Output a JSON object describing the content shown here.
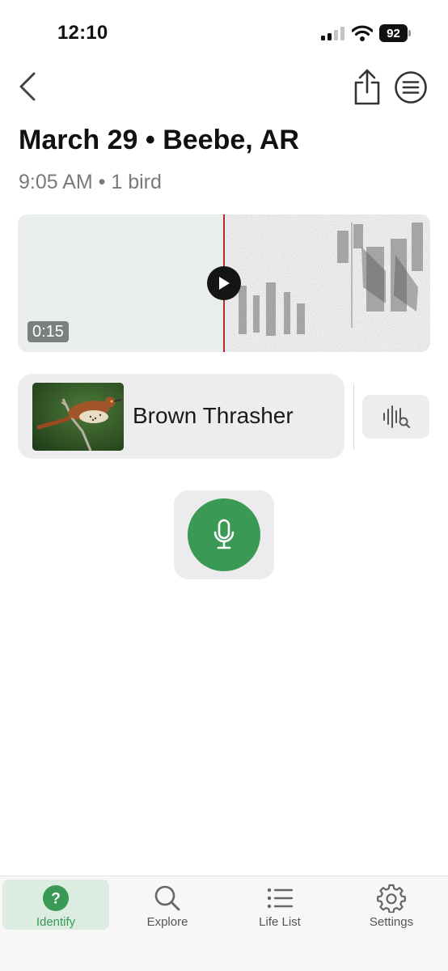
{
  "status_bar": {
    "time": "12:10",
    "battery": "92"
  },
  "header": {
    "title": "March 29 • Beebe, AR",
    "subtitle": "9:05 AM • 1 bird"
  },
  "recording": {
    "duration": "0:15"
  },
  "species": {
    "name": "Brown Thrasher"
  },
  "tabs": [
    {
      "label": "Identify",
      "icon": "question-circle-icon",
      "active": true
    },
    {
      "label": "Explore",
      "icon": "search-icon",
      "active": false
    },
    {
      "label": "Life List",
      "icon": "list-icon",
      "active": false
    },
    {
      "label": "Settings",
      "icon": "gear-icon",
      "active": false
    }
  ],
  "colors": {
    "accent": "#3a9a55",
    "playhead": "#b52a2a",
    "tab_active_bg": "#dcece0"
  }
}
